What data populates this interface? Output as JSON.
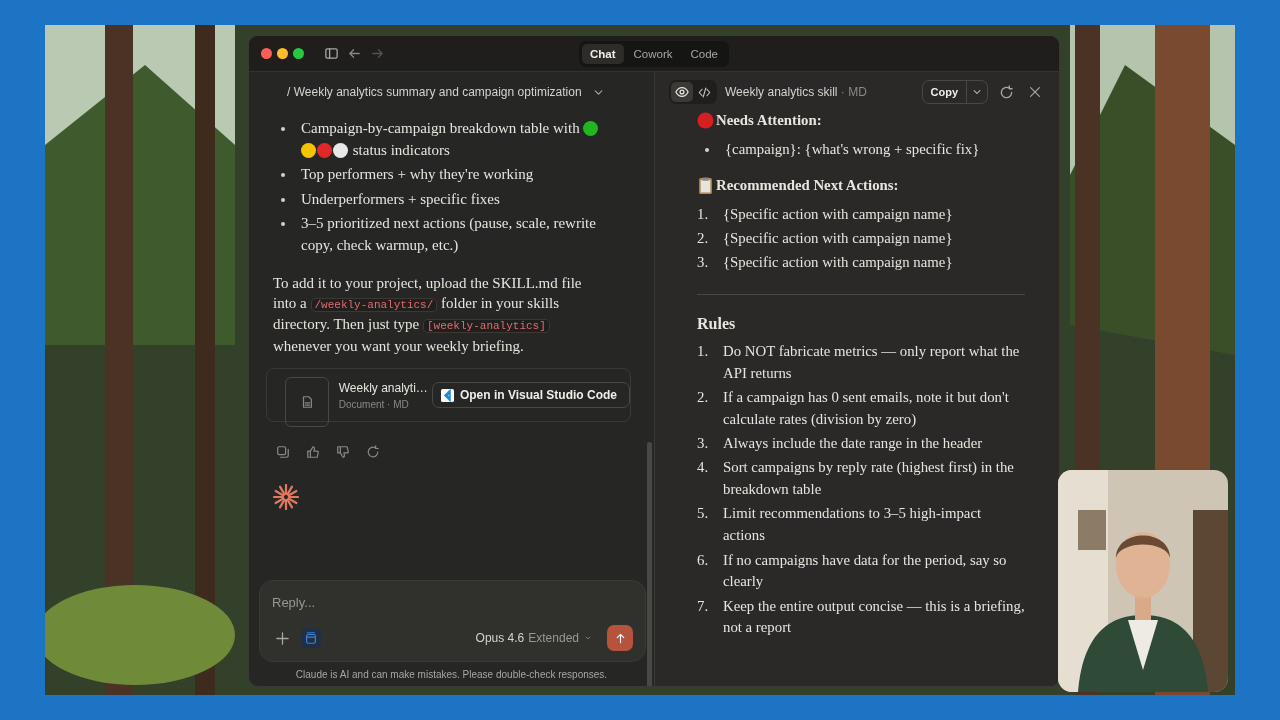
{
  "window": {
    "tabs": [
      {
        "label": "Chat",
        "selected": true
      },
      {
        "label": "Cowork",
        "selected": false
      },
      {
        "label": "Code",
        "selected": false
      }
    ]
  },
  "chat": {
    "title": "/ Weekly analytics summary and campaign optimization",
    "bullets": [
      {
        "text": "Campaign-by-campaign breakdown table with",
        "status_dots": [
          {
            "color": "#1fb81f"
          },
          {
            "color": "#f5c400"
          },
          {
            "color": "#e02828"
          },
          {
            "color": "#e8e8e8"
          }
        ],
        "text_after": "status indicators"
      },
      {
        "text": "Top performers + why they're working"
      },
      {
        "text": "Underperformers + specific fixes"
      },
      {
        "text": "3–5 prioritized next actions (pause, scale, rewrite copy, check warmup, etc.)"
      }
    ],
    "paragraph": [
      {
        "kind": "text",
        "text": "To add it to your project, upload the SKILL.md file into a "
      },
      {
        "kind": "code",
        "text": "/weekly-analytics/"
      },
      {
        "kind": "text",
        "text": " folder in your skills directory. Then just type "
      },
      {
        "kind": "code",
        "text": "[weekly-analytics]"
      },
      {
        "kind": "text",
        "text": " whenever you want your weekly briefing."
      }
    ],
    "attachment": {
      "name": "Weekly analyti…",
      "meta": "Document · MD",
      "action": "Open in Visual Studio Code"
    },
    "composer": {
      "placeholder": "Reply...",
      "model": "Opus 4.6",
      "mode": "Extended"
    },
    "disclaimer": "Claude is AI and can make mistakes. Please double-check responses."
  },
  "preview": {
    "title": "Weekly analytics skill",
    "format": "· MD",
    "view_modes": [
      {
        "kind": "preview",
        "selected": true
      },
      {
        "kind": "code",
        "selected": false
      }
    ],
    "copy_label": "Copy",
    "sections": [
      {
        "kind": "alert-heading",
        "text": "Needs Attention:"
      },
      {
        "kind": "bullets",
        "items": [
          "{campaign}: {what's wrong + specific fix}"
        ]
      },
      {
        "kind": "actions-heading",
        "text": "Recommended Next Actions:"
      },
      {
        "kind": "numbered",
        "items": [
          {
            "number": "1.",
            "text": "{Specific action with campaign name}"
          },
          {
            "number": "2.",
            "text": "{Specific action with campaign name}"
          },
          {
            "number": "3.",
            "text": "{Specific action with campaign name}"
          }
        ]
      },
      {
        "kind": "rule"
      },
      {
        "kind": "title",
        "text": "Rules"
      },
      {
        "kind": "numbered",
        "items": [
          {
            "number": "1.",
            "text": "Do NOT fabricate metrics — only report what the API returns"
          },
          {
            "number": "2.",
            "text": "If a campaign has 0 sent emails, note it but don't calculate rates (division by zero)"
          },
          {
            "number": "3.",
            "text": "Always include the date range in the header"
          },
          {
            "number": "4.",
            "text": "Sort campaigns by reply rate (highest first) in the breakdown table"
          },
          {
            "number": "5.",
            "text": "Limit recommendations to 3–5 high-impact actions"
          },
          {
            "number": "6.",
            "text": "If no campaigns have data for the period, say so clearly"
          },
          {
            "number": "7.",
            "text": "Keep the entire output concise — this is a briefing, not a report"
          }
        ]
      }
    ]
  }
}
